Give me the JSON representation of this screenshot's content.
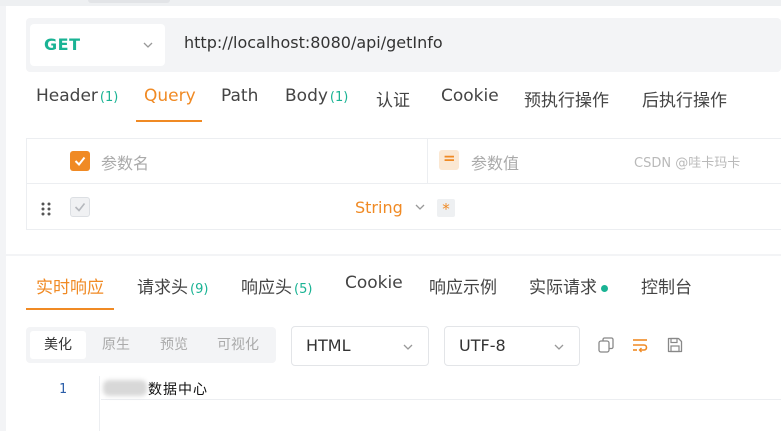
{
  "request": {
    "method": "GET",
    "url": "http://localhost:8080/api/getInfo",
    "tabs": [
      {
        "label": "Header",
        "count": "(1)"
      },
      {
        "label": "Query",
        "count": ""
      },
      {
        "label": "Path",
        "count": ""
      },
      {
        "label": "Body",
        "count": "(1)"
      },
      {
        "label": "认证",
        "count": ""
      },
      {
        "label": "Cookie",
        "count": ""
      },
      {
        "label": "预执行操作",
        "count": ""
      },
      {
        "label": "后执行操作",
        "count": ""
      }
    ],
    "active_tab": "Query",
    "params": {
      "name_placeholder": "参数名",
      "equals_symbol": "=",
      "value_placeholder": "参数值",
      "row_type": "String",
      "required_mark": "*"
    }
  },
  "response": {
    "tabs": [
      {
        "label": "实时响应",
        "count": ""
      },
      {
        "label": "请求头",
        "count": "(9)"
      },
      {
        "label": "响应头",
        "count": "(5)"
      },
      {
        "label": "Cookie",
        "count": ""
      },
      {
        "label": "响应示例",
        "count": ""
      },
      {
        "label": "实际请求",
        "count": ""
      },
      {
        "label": "控制台",
        "count": ""
      }
    ],
    "active_tab": "实时响应",
    "view_modes": [
      "美化",
      "原生",
      "预览",
      "可视化"
    ],
    "active_view": "美化",
    "format": "HTML",
    "encoding": "UTF-8",
    "editor": {
      "line_number": "1",
      "content": "数据中心"
    }
  },
  "watermark": "CSDN @哇卡玛卡",
  "colors": {
    "accent": "#f08a24",
    "method_green": "#1ab394",
    "status_dot": "#1ab394"
  },
  "icons": [
    "chevron-down-icon",
    "checkbox-checked-icon",
    "drag-handle-icon",
    "copy-icon",
    "wrap-lines-icon",
    "save-icon"
  ]
}
